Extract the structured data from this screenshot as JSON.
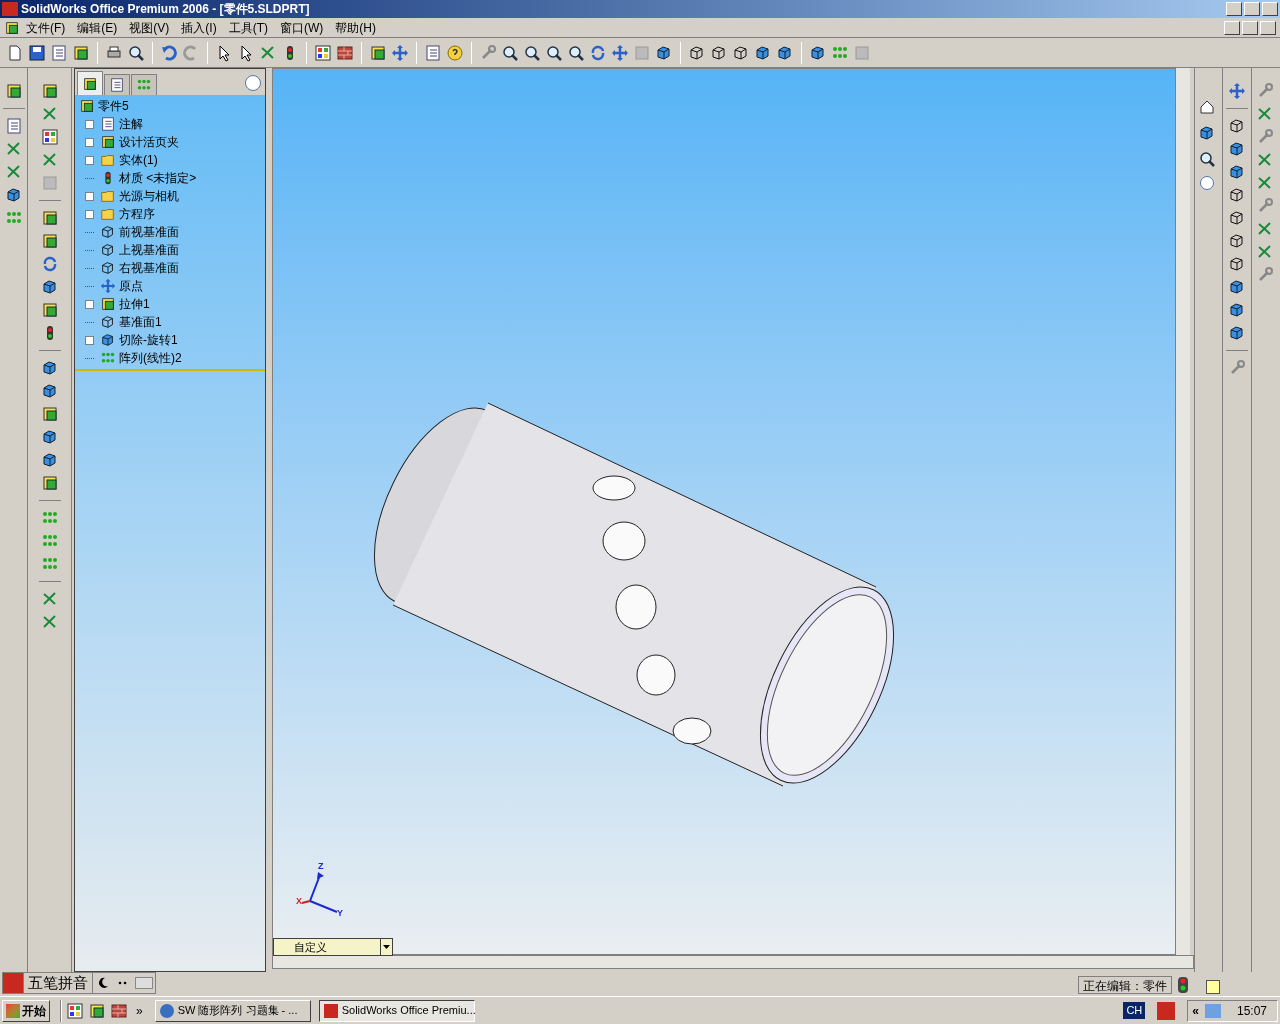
{
  "window": {
    "title": "SolidWorks Office Premium 2006 - [零件5.SLDPRT]"
  },
  "menu": [
    "文件(F)",
    "编辑(E)",
    "视图(V)",
    "插入(I)",
    "工具(T)",
    "窗口(W)",
    "帮助(H)"
  ],
  "panel_tabs": [
    {
      "selected": true
    },
    {
      "selected": false
    },
    {
      "selected": false
    }
  ],
  "tree": {
    "root": "零件5",
    "items": [
      {
        "label": "注解",
        "kind": "annotation",
        "expandable": true
      },
      {
        "label": "设计活页夹",
        "kind": "binder",
        "expandable": true
      },
      {
        "label": "实体(1)",
        "kind": "folder",
        "expandable": true
      },
      {
        "label": "材质 <未指定>",
        "kind": "material",
        "expandable": false
      },
      {
        "label": "光源与相机",
        "kind": "lights",
        "expandable": true
      },
      {
        "label": "方程序",
        "kind": "equation",
        "expandable": true
      },
      {
        "label": "前视基准面",
        "kind": "plane",
        "expandable": false
      },
      {
        "label": "上视基准面",
        "kind": "plane",
        "expandable": false
      },
      {
        "label": "右视基准面",
        "kind": "plane",
        "expandable": false
      },
      {
        "label": "原点",
        "kind": "origin",
        "expandable": false
      },
      {
        "label": "拉伸1",
        "kind": "extrude",
        "expandable": true
      },
      {
        "label": "基准面1",
        "kind": "plane",
        "expandable": false
      },
      {
        "label": "切除-旋转1",
        "kind": "cut",
        "expandable": true
      },
      {
        "label": "阵列(线性)2",
        "kind": "pattern",
        "expandable": false
      }
    ]
  },
  "viewport": {
    "triad": {
      "z": "Z",
      "x": "X",
      "y": "Y"
    },
    "view_dropdown": "自定义"
  },
  "ime_bar": {
    "label": "五笔拼音"
  },
  "status_bar": {
    "text": "正在编辑：零件"
  },
  "taskbar": {
    "start": "开始",
    "quick_launch_more": "»",
    "tasks": [
      {
        "label": "SW 随形阵列 习题集 - ...",
        "selected": false
      },
      {
        "label": "SolidWorks Office Premiu...",
        "selected": true
      }
    ],
    "tray": {
      "language": "CH",
      "collapse": "«",
      "time": "15:07"
    }
  }
}
